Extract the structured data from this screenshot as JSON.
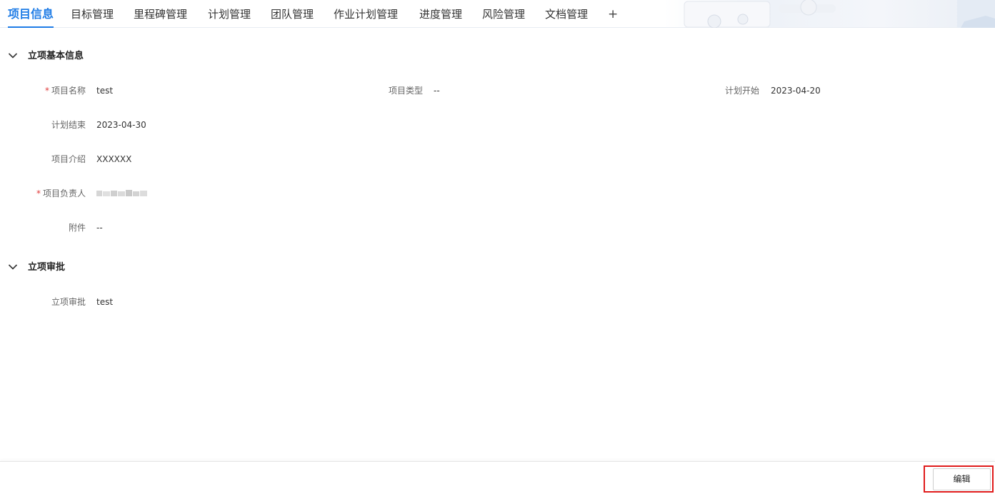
{
  "tabs": [
    {
      "label": "项目信息",
      "active": true
    },
    {
      "label": "目标管理"
    },
    {
      "label": "里程碑管理"
    },
    {
      "label": "计划管理"
    },
    {
      "label": "团队管理"
    },
    {
      "label": "作业计划管理"
    },
    {
      "label": "进度管理"
    },
    {
      "label": "风险管理"
    },
    {
      "label": "文档管理"
    },
    {
      "label": "+"
    }
  ],
  "basic_info": {
    "title": "立项基本信息",
    "fields": {
      "name": {
        "label": "项目名称",
        "value": "test",
        "required": "*"
      },
      "type": {
        "label": "项目类型",
        "value": "--"
      },
      "plan_start": {
        "label": "计划开始",
        "value": "2023-04-20"
      },
      "plan_end": {
        "label": "计划结束",
        "value": "2023-04-30"
      },
      "intro": {
        "label": "项目介绍",
        "value": "XXXXXX"
      },
      "owner": {
        "label": "项目负责人",
        "required": "*"
      },
      "attachment": {
        "label": "附件",
        "value": "--"
      }
    }
  },
  "approval": {
    "title": "立项审批",
    "fields": {
      "approval": {
        "label": "立项审批",
        "value": "test"
      }
    }
  },
  "footer": {
    "edit_label": "编辑"
  },
  "colors": {
    "accent": "#1e7ce6",
    "required": "#e03a3a",
    "highlight": "#e01b1b"
  }
}
